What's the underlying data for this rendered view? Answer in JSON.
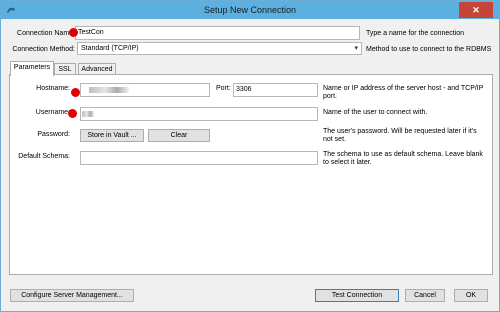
{
  "window": {
    "title": "Setup New Connection",
    "close_glyph": "✕"
  },
  "connection_name": {
    "label": "Connection Name:",
    "value": "TestCon",
    "hint": "Type a name for the connection"
  },
  "connection_method": {
    "label": "Connection Method:",
    "value": "Standard (TCP/IP)",
    "hint": "Method to use to connect to the RDBMS"
  },
  "tabs": [
    {
      "label": "Parameters",
      "active": true
    },
    {
      "label": "SSL",
      "active": false
    },
    {
      "label": "Advanced",
      "active": false
    }
  ],
  "parameters": {
    "hostname": {
      "label": "Hostname:",
      "hint": "Name or IP address of the server host - and TCP/IP port."
    },
    "port": {
      "label": "Port:",
      "value": "3306"
    },
    "username": {
      "label": "Username:",
      "hint": "Name of the user to connect with."
    },
    "password": {
      "label": "Password:",
      "store_button": "Store in Vault ...",
      "clear_button": "Clear",
      "hint": "The user's password. Will be requested later if it's not set."
    },
    "default_schema": {
      "label": "Default Schema:",
      "value": "",
      "hint": "The schema to use as default schema. Leave blank to select it later."
    }
  },
  "footer": {
    "configure_button": "Configure Server Management...",
    "test_button": "Test Connection",
    "cancel_button": "Cancel",
    "ok_button": "OK"
  },
  "colors": {
    "titlebar": "#5bb0e0",
    "close": "#c7443a",
    "marker": "#e00000"
  },
  "icons": {
    "app": "mysql-workbench-icon",
    "dropdown": "chevron-down-icon"
  }
}
